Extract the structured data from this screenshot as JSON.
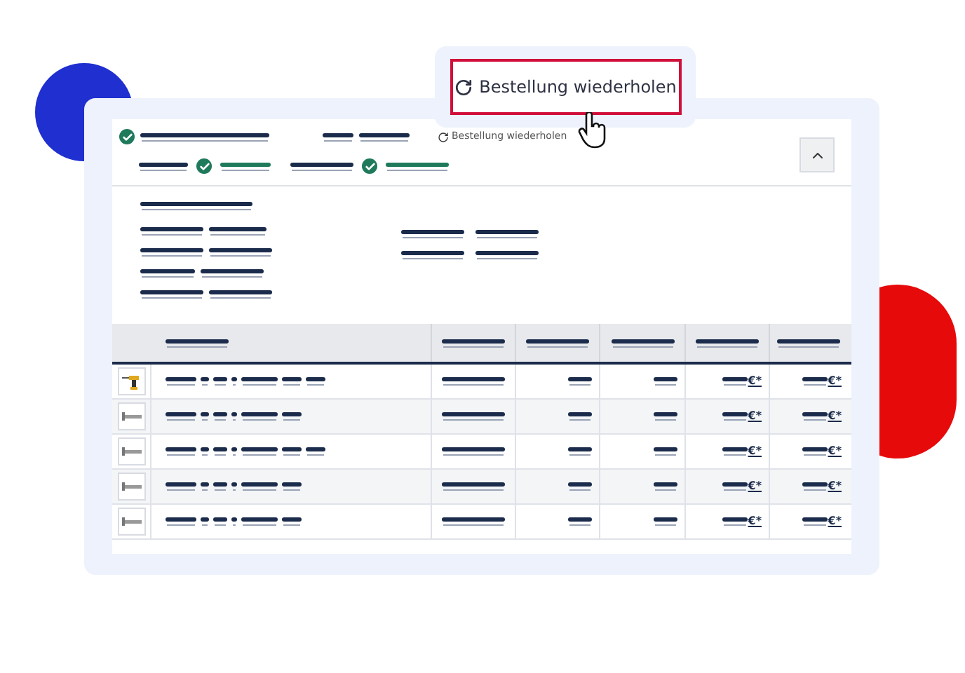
{
  "popup": {
    "button": "Bestellung wiederholen"
  },
  "order": {
    "reorder_link": "Bestellung wiederholen",
    "expanded": true,
    "steps": [
      {
        "done": true
      },
      {
        "done": true
      },
      {
        "done": true
      }
    ]
  },
  "table": {
    "rows": [
      {
        "kind": "drill",
        "price_unit": "€*",
        "total_unit": "€*"
      },
      {
        "kind": "screw",
        "price_unit": "€*",
        "total_unit": "€*"
      },
      {
        "kind": "screw",
        "price_unit": "€*",
        "total_unit": "€*"
      },
      {
        "kind": "screw",
        "price_unit": "€*",
        "total_unit": "€*"
      },
      {
        "kind": "screw",
        "price_unit": "€*",
        "total_unit": "€*"
      }
    ]
  }
}
